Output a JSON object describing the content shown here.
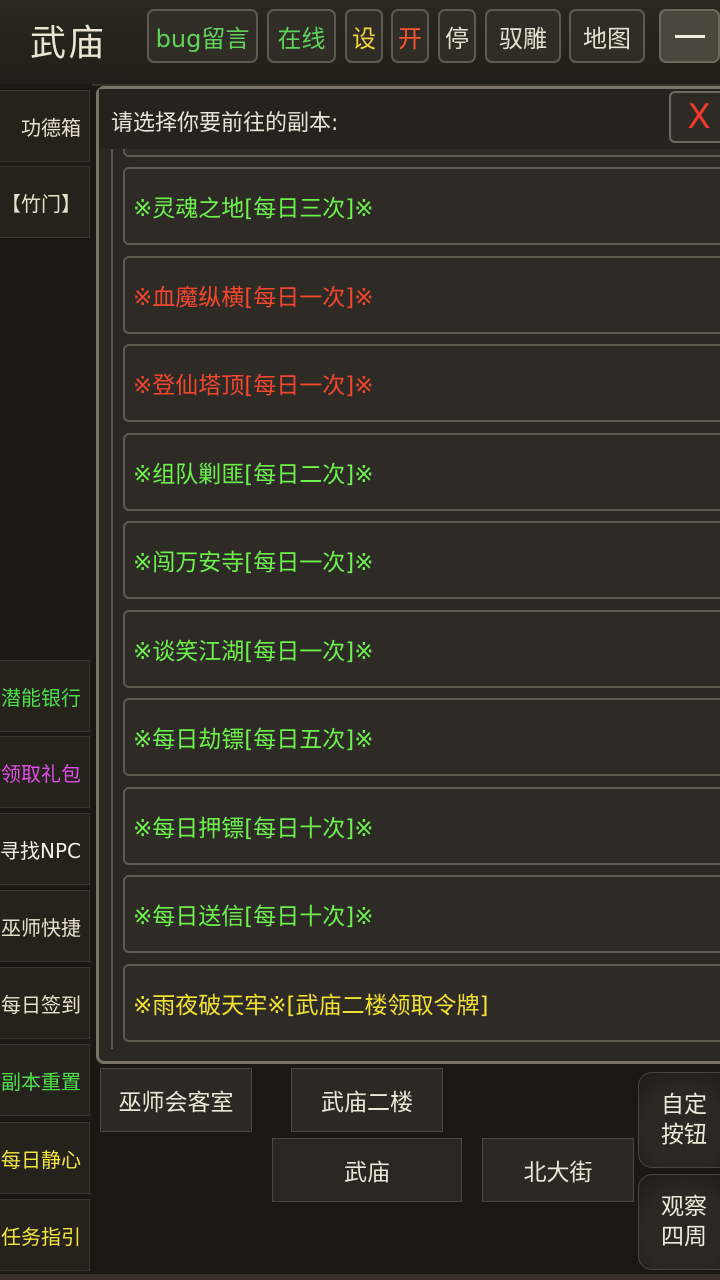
{
  "topbar": {
    "location": "武庙",
    "buttons": {
      "bug": "bug留言",
      "online": "在线",
      "settings": "设",
      "start": "开",
      "stop": "停",
      "vulture": "驭雕",
      "map": "地图"
    }
  },
  "sidebar": {
    "items": [
      {
        "label": "功德箱"
      },
      {
        "label": "【竹门】"
      },
      {
        "label": "潜能银行"
      },
      {
        "label": "领取礼包"
      },
      {
        "label": "寻找NPC"
      },
      {
        "label": "巫师快捷"
      },
      {
        "label": "每日签到"
      },
      {
        "label": "副本重置"
      },
      {
        "label": "每日静心"
      },
      {
        "label": "任务指引"
      }
    ]
  },
  "dialog": {
    "prompt": "请选择你要前往的副本:",
    "close_label": "X",
    "items": [
      {
        "label": "※灵魂之地[每日三次]※"
      },
      {
        "label": "※血魔纵横[每日一次]※"
      },
      {
        "label": "※登仙塔顶[每日一次]※"
      },
      {
        "label": "※组队剿匪[每日二次]※"
      },
      {
        "label": "※闯万安寺[每日一次]※"
      },
      {
        "label": "※谈笑江湖[每日一次]※"
      },
      {
        "label": "※每日劫镖[每日五次]※"
      },
      {
        "label": "※每日押镖[每日十次]※"
      },
      {
        "label": "※每日送信[每日十次]※"
      },
      {
        "label": "※雨夜破天牢※[武庙二楼领取令牌]"
      }
    ]
  },
  "exits": {
    "wizard_room": "巫师会客室",
    "upstairs": "武庙二楼",
    "current": "武庙",
    "north_street": "北大街"
  },
  "side_buttons": {
    "custom": "自定按钮",
    "look": "观察四周"
  },
  "colors": {
    "green": "#6cf24a",
    "red": "#f4462c",
    "yellow": "#f3e12f",
    "close_red": "#f03a2a"
  }
}
